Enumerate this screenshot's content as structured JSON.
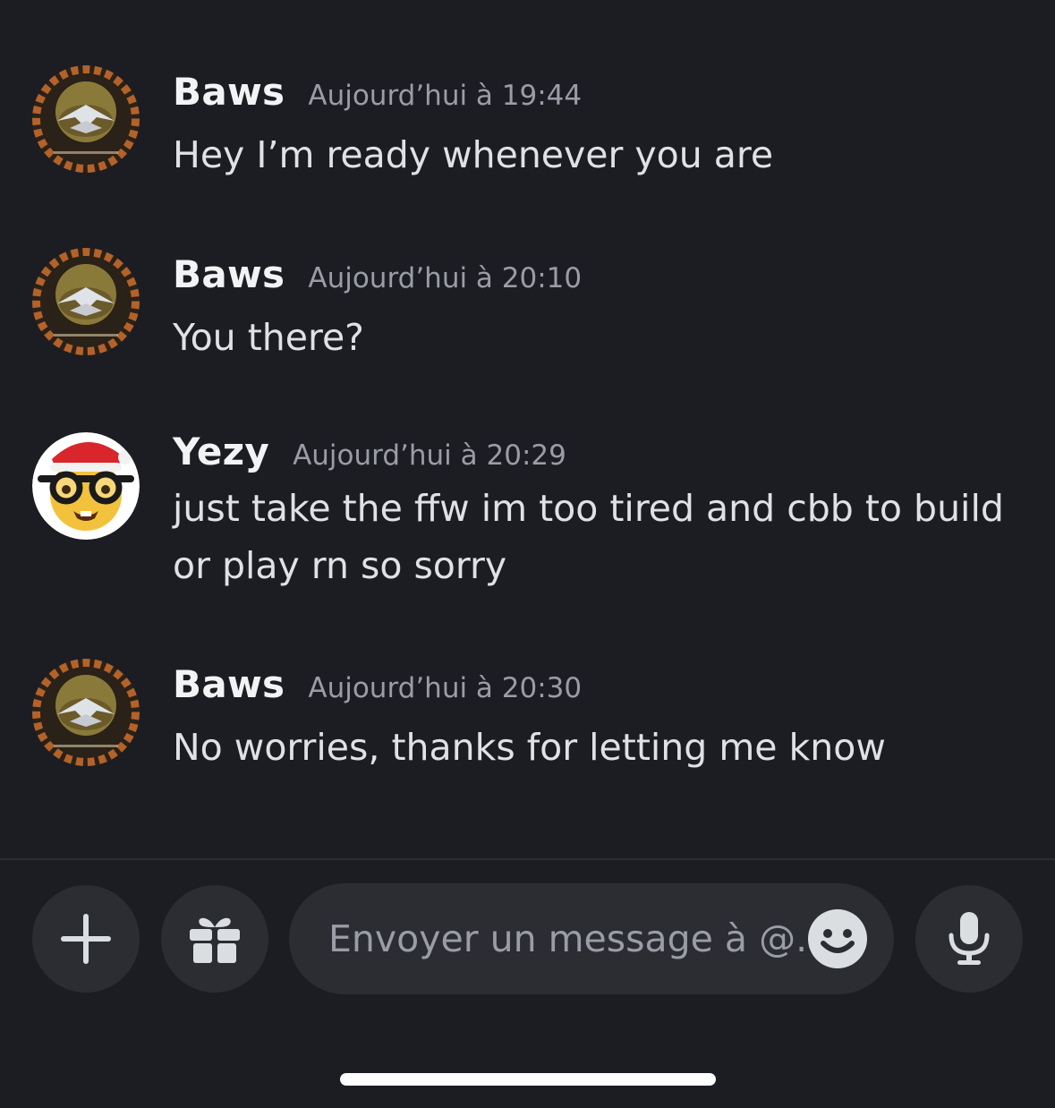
{
  "messages": [
    {
      "author": "Baws",
      "timestamp": "Aujourd’hui à 19:44",
      "text": "Hey I’m ready whenever you are",
      "avatar": "baws-avatar"
    },
    {
      "author": "Baws",
      "timestamp": "Aujourd’hui à 20:10",
      "text": "You there?",
      "avatar": "baws-avatar"
    },
    {
      "author": "Yezy",
      "timestamp": "Aujourd’hui à 20:29",
      "text": "just take the ffw im too tired and cbb to build or play rn so sorry",
      "avatar": "nerd-santa-avatar"
    },
    {
      "author": "Baws",
      "timestamp": "Aujourd’hui à 20:30",
      "text": "No worries, thanks for letting me know",
      "avatar": "baws-avatar"
    }
  ],
  "composer": {
    "placeholder": "Envoyer un message à @..",
    "add_icon": "plus-icon",
    "gift_icon": "gift-icon",
    "emoji_icon": "emoji-icon",
    "mic_icon": "microphone-icon"
  },
  "colors": {
    "background": "#1c1d22",
    "surface": "#2b2d33",
    "text_primary": "#f2f3f5",
    "text_muted": "#9a9ca6"
  }
}
